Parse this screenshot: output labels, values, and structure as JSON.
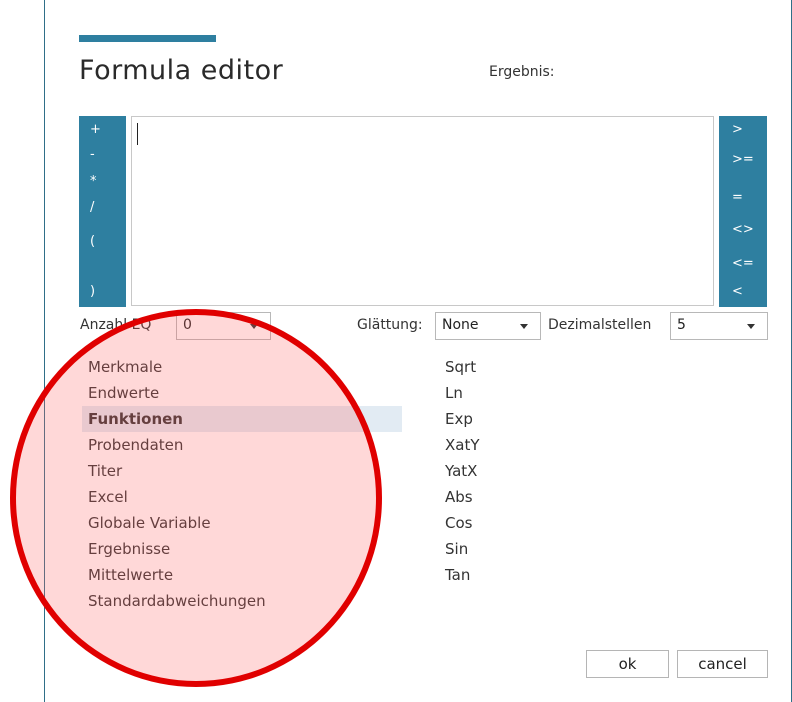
{
  "dialog": {
    "title": "Formula editor",
    "result_label": "Ergebnis:"
  },
  "operators_left": [
    "+",
    "-",
    "*",
    "/",
    "(",
    ")"
  ],
  "operators_right": [
    ">",
    ">=",
    "=",
    "<>",
    "<=",
    "<"
  ],
  "editor": {
    "value": ""
  },
  "controls": {
    "anzahl_label": "Anzahl EQ",
    "anzahl_value": "0",
    "glaettung_label": "Glättung:",
    "glaettung_value": "None",
    "dezimal_label": "Dezimalstellen",
    "dezimal_value": "5"
  },
  "categories": [
    "Merkmale",
    "Endwerte",
    "Funktionen",
    "Probendaten",
    "Titer",
    "Excel",
    "Globale Variable",
    "Ergebnisse",
    "Mittelwerte",
    "Standardabweichungen"
  ],
  "selected_category": "Funktionen",
  "functions": [
    "Sqrt",
    "Ln",
    "Exp",
    "XatY",
    "YatX",
    "Abs",
    "Cos",
    "Sin",
    "Tan"
  ],
  "buttons": {
    "ok": "ok",
    "cancel": "cancel"
  },
  "colors": {
    "accent": "#2e7fa0",
    "annotation": "#e00000"
  }
}
